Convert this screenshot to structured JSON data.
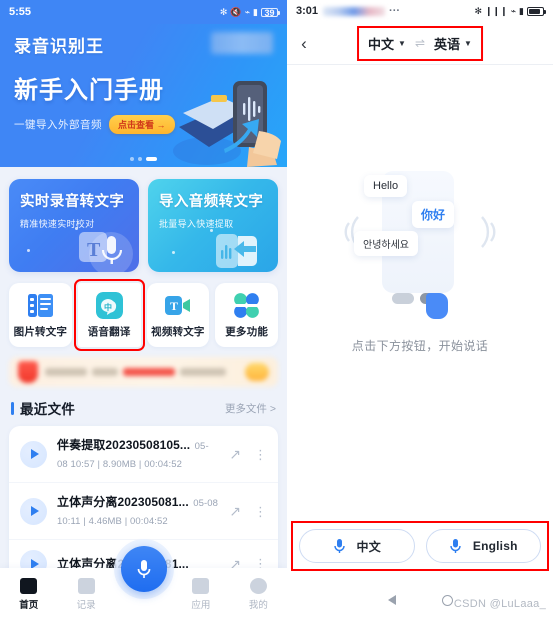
{
  "left": {
    "status": {
      "time": "5:55",
      "battery_level": "39",
      "icons": [
        "bluetooth-icon",
        "mute-icon",
        "wifi-icon",
        "signal-icon",
        "battery-icon"
      ]
    },
    "hero": {
      "brand": "录音识别王",
      "title": "新手入门手册",
      "subtitle": "一键导入外部音频",
      "cta": "点击查看 →",
      "dots": 3,
      "active_dot": 3
    },
    "big_cards": [
      {
        "title": "实时录音转文字",
        "subtitle": "精准快速实时校对",
        "color": "#4a8bf7"
      },
      {
        "title": "导入音频转文字",
        "subtitle": "批量导入快速提取",
        "color": "#35b8ea"
      }
    ],
    "quick_actions": [
      {
        "label": "图片转文字",
        "icon": "image-to-text-icon",
        "highlighted": false
      },
      {
        "label": "语音翻译",
        "icon": "voice-translate-icon",
        "highlighted": true
      },
      {
        "label": "视频转文字",
        "icon": "video-to-text-icon",
        "highlighted": false
      },
      {
        "label": "更多功能",
        "icon": "grid-more-icon",
        "highlighted": false
      }
    ],
    "section": {
      "title": "最近文件",
      "more": "更多文件 >"
    },
    "files": [
      {
        "name": "伴奏提取20230508105...",
        "date": "05-08 10:57",
        "size": "8.90MB",
        "duration": "00:04:52"
      },
      {
        "name": "立体声分离202305081...",
        "date": "05-08 10:11",
        "size": "4.46MB",
        "duration": "00:04:52"
      },
      {
        "name": "立体声分离202305081...",
        "date": "",
        "size": "",
        "duration": ""
      }
    ],
    "tabs": [
      {
        "label": "首页",
        "icon": "home-icon",
        "active": true
      },
      {
        "label": "记录",
        "icon": "records-icon",
        "active": false
      },
      {
        "label": "应用",
        "icon": "apps-icon",
        "active": false
      },
      {
        "label": "我的",
        "icon": "profile-icon",
        "active": false
      }
    ],
    "fab": {
      "icon": "microphone-icon"
    }
  },
  "right": {
    "status": {
      "time": "3:01",
      "ellipsis": "···",
      "icons": [
        "bluetooth-icon",
        "vibrate-icon",
        "wifi-icon",
        "signal-icon",
        "battery-icon"
      ]
    },
    "header": {
      "back_icon": "chevron-left-icon",
      "source_lang": "中文",
      "target_lang": "英语",
      "swap_icon": "swap-arrows-icon",
      "caret": "▼",
      "highlight_color": "#ff0000"
    },
    "illustration": {
      "bubble_en": "Hello",
      "bubble_zh": "你好",
      "bubble_ko": "안녕하세요"
    },
    "hint": "点击下方按钮，开始说话",
    "mic_buttons": [
      {
        "label": "中文",
        "icon": "microphone-icon"
      },
      {
        "label": "English",
        "icon": "microphone-icon"
      }
    ],
    "android_nav": [
      "back-triangle-icon",
      "home-circle-icon"
    ],
    "watermark": "CSDN @LuLaaa_"
  }
}
